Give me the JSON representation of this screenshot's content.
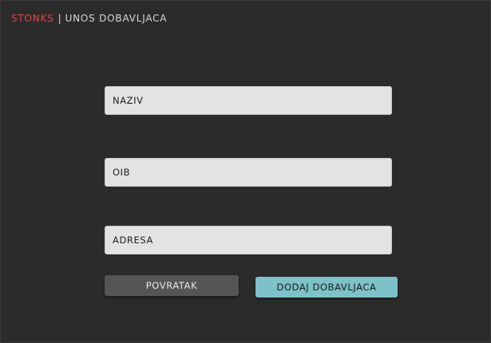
{
  "header": {
    "brand": "STONKS",
    "separator": "|",
    "title": "UNOS DOBAVLJACA"
  },
  "form": {
    "naziv_placeholder": "NAZIV",
    "oib_placeholder": "OIB",
    "adresa_placeholder": "ADRESA",
    "naziv_value": "",
    "oib_value": "",
    "adresa_value": ""
  },
  "actions": {
    "back_label": "POVRATAK",
    "submit_label": "DODAJ DOBAVLJACA"
  },
  "colors": {
    "background": "#2b2b2b",
    "brand": "#e0454c",
    "submit_button": "#7cc2c8",
    "back_button": "#555555"
  }
}
